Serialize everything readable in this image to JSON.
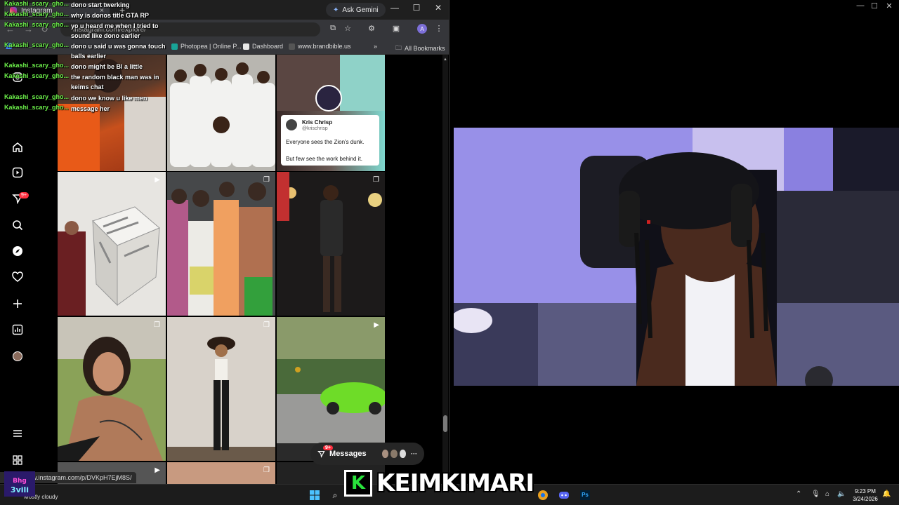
{
  "browser": {
    "tab_title": "Instagram",
    "tab_close": "×",
    "new_tab": "+",
    "ask_gemini": "Ask Gemini",
    "window_controls": [
      "—",
      "☐",
      "✕"
    ],
    "url": "instagram.com/explore/",
    "bookmarks": [
      {
        "label": "",
        "color": "#4285f4"
      },
      {
        "label": "",
        "color": "#8ab4f8"
      },
      {
        "label": "Photopea | Online P...",
        "color": "#18a497"
      },
      {
        "label": "Dashboard",
        "color": "#e8e8e8"
      },
      {
        "label": "www.brandbible.us",
        "color": "#555"
      }
    ],
    "more_bookmarks": "»",
    "all_bookmarks": "All Bookmarks",
    "profile_initial": "A",
    "status_url": "https://www.instagram.com/p/DVKpH7EjM8S/"
  },
  "instagram": {
    "notification_badge": "9+",
    "tweet": {
      "name": "Kris Chrisp",
      "handle": "@krischrisp",
      "line1": "Everyone sees the Zion's dunk.",
      "line2": "But few see the work behind it."
    },
    "messages": {
      "label": "Messages",
      "badge": "9+",
      "more": "···"
    }
  },
  "chat": [
    {
      "user": "Kakashi_scary_gho...",
      "message": "dono start twerking"
    },
    {
      "user": "Kakashi_scary_gho...",
      "message": "why is donos title GTA RP"
    },
    {
      "user": "Kakashi_scary_gho...",
      "message": "yo u heard me when I tried to sound like dono earlier"
    },
    {
      "user": "Kakashi_scary_gho...",
      "message": "dono u said u was gonna touch balls earlier"
    },
    {
      "user": "Kakashi_scary_gho...",
      "message": "dono might be BI a little"
    },
    {
      "user": "Kakashi_scary_gho...",
      "message": "the random black man was in keims chat"
    },
    {
      "user": "Kakashi_scary_gho...",
      "message": "dono we know u like men"
    },
    {
      "user": "Kakashi_scary_gho...",
      "message": "message her"
    }
  ],
  "stream": {
    "watermark_logo": "K",
    "watermark_name": "KEIMKIMARI",
    "channel_badge_text": "Bhg 3vili"
  },
  "taskbar": {
    "weather": "Mostly cloudy",
    "time": "9:23 PM",
    "date": "3/24/2026",
    "discord_badge": "9+"
  }
}
